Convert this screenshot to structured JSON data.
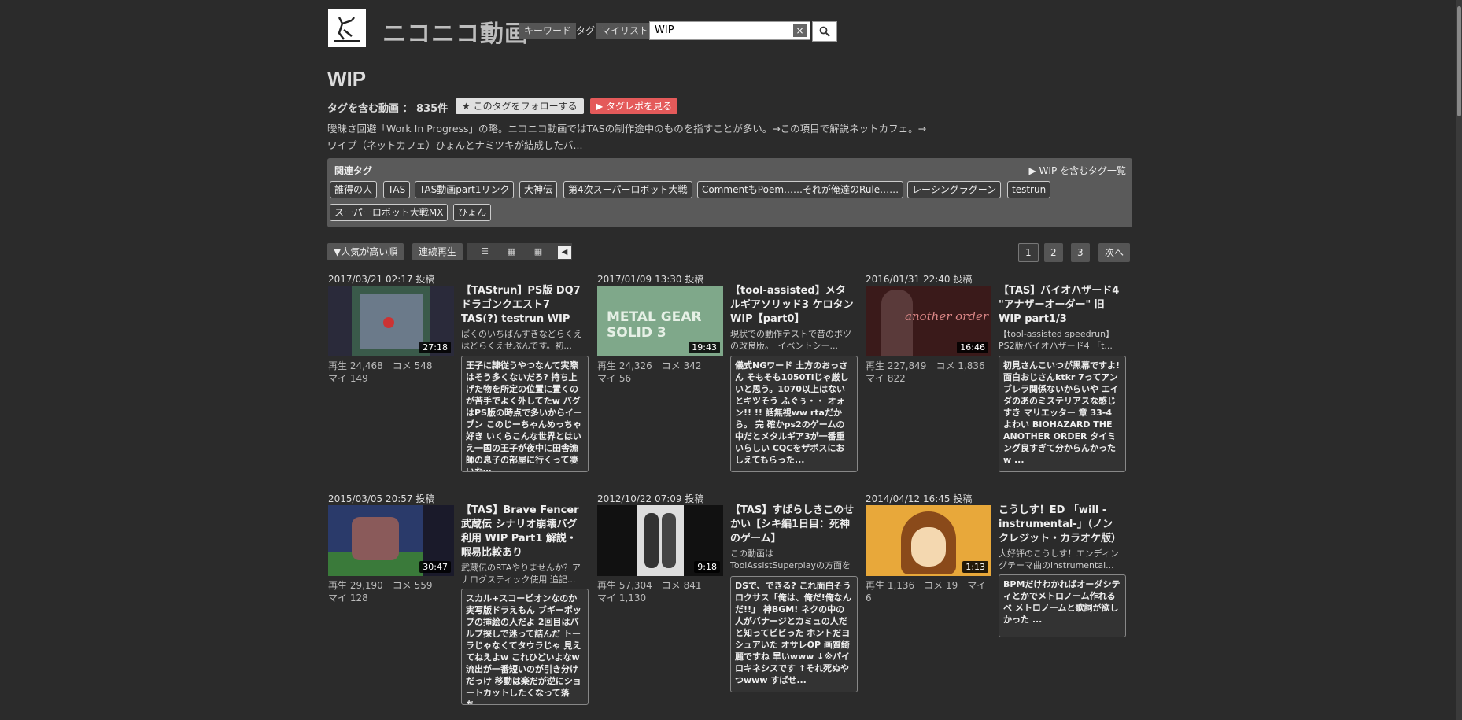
{
  "header": {
    "logo_text": "ニコニコ動画",
    "search_tabs": [
      "キーワード",
      "タグ",
      "マイリスト"
    ],
    "search_value": "WIP",
    "clear_symbol": "×",
    "search_icon": "magnifier-icon"
  },
  "tag_page": {
    "title": "WIP",
    "count_label": "タグを含む動画 ： 835件",
    "follow_label": "★ このタグをフォローする",
    "repo_label": "▶ タグレポを見る",
    "description": "曖昧さ回避「Work In Progress」の略。ニコニコ動画ではTASの制作途中のものを指すことが多い。→この項目で解説ネットカフェ。→ワイプ（ネットカフェ）ひょんとナミツキが結成したバ..."
  },
  "related": {
    "title": "関連タグ",
    "all_link": "▶ WIP を含むタグ一覧",
    "tags": [
      "誰得の人",
      "TAS",
      "TAS動画part1リンク",
      "大神伝",
      "第4次スーパーロボット大戦",
      "CommentもPoem……それが俺達のRule……",
      "レーシングラグーン",
      "testrun",
      "スーパーロボット大戦MX",
      "ひょん"
    ]
  },
  "controls": {
    "sort_label": "▼人気が高い順",
    "continuous_label": "連続再生",
    "view_icons": [
      "list-view-icon",
      "grid-small-icon",
      "grid-large-icon"
    ],
    "collapse_symbol": "◀",
    "pages": [
      "1",
      "2",
      "3"
    ],
    "next_label": "次へ"
  },
  "videos": [
    {
      "date": "2017/03/21 02:17 投稿",
      "duration": "27:18",
      "title": "【TAStrun】PS版 DQ7 ドラゴンクエスト7 TAS(?) testrun WIP",
      "stats": "再生 24,468　コメ 548\nマイ 149",
      "desc": "ぱくのいちばんすきなどらくえはどらくえせぶんです。初...",
      "comments": "王子に隷従うやつなんて実際はそう多くないだろ? 持ち上げた物を所定の位置に置くのが苦手でよく外してたw バグはPS版の時点で多いからイーブン このじーちゃんめっちゃ好き いくらこんな世界とはいえ一国の王子が夜中に田舎漁師の息子の部屋に行くって凄いなw...",
      "thumb_color": "#2a2a3a"
    },
    {
      "date": "2017/01/09 13:30 投稿",
      "duration": "19:43",
      "title": "【tool-assisted】メタルギアソリッド3 ケロタン WIP【part0】",
      "stats": "再生 24,326　コメ 342\nマイ 56",
      "desc": "現状での動作テストで昔のボツの改良版。　イベントシー...",
      "comments": "儀式NGワード 土方のおっさん そもそも1050Tiじゃ厳しいと思う。1070以上はないとキツそう ふぐぅ・・ オォン!! !! 話無視ww rtaだから。 完 確かps2のゲームの中だとメタルギア3が一番重いらしい CQCをザボスにおしえてもらった...",
      "thumb_color": "#7fa88a",
      "thumb_text": "METAL GEAR SOLID 3"
    },
    {
      "date": "2016/01/31 22:40 投稿",
      "duration": "16:46",
      "title": "【TAS】バイオハザード4 \"アナザーオーダー\" 旧 WIP part1/3",
      "stats": "再生 227,849　コメ 1,836\nマイ 822",
      "desc": "【tool-assisted speedrun】PS2版バイオハザード4 「t...",
      "comments": "初見さんこいつが黒幕ですよ! 面白おじさんktkr 7ってアンブレラ関係ないからいや エイダのあのミステリアスな感じすき マリエッター 章 33-4 よわい BIOHAZARD THE ANOTHER ORDER タイミング良すぎて分からんかったw ...",
      "thumb_color": "#5a2a2a",
      "thumb_text": "another order"
    },
    {
      "date": "2015/03/05 20:57 投稿",
      "duration": "30:47",
      "title": "【TAS】Brave Fencer 武蔵伝 シナリオ崩壊バグ利用 WIP Part1 解説・暇易比較あり",
      "stats": "再生 29,190　コメ 559\nマイ 128",
      "desc": "武蔵伝のRTAやりませんか？アナログスティック使用 追記...",
      "comments": "スカル+スコーピオンなのか 実写版ドラえもん ブギーポップの挿絵の人だよ 2回目はバルブ探しで迷って詰んだ トーラじゃなくてタウラじゃ 見えてねえよw これひどいよなw 流出が一番短いのが引き分けだっけ 移動は楽だが逆にショートカットしたくなって落ち...",
      "thumb_color": "#3a4a7a"
    },
    {
      "date": "2012/10/22 07:09 投稿",
      "duration": "9:18",
      "title": "【TAS】すばらしきこのせかい【シキ編1日目：死神のゲーム】",
      "stats": "再生 57,304　コメ 841\nマイ 1,130",
      "desc": "この動画はToolAssistSuperplayの方面を目指していきます...",
      "comments": "DSで、できる? これ面白そう ロクサス「俺は、俺だ!俺なんだ!!」 神BGM! ネクの中の人がバナージとカミュの人だと知ってビビった ホントだヨシュアいた オサレOP 画質綺麗ですね 早いwww ↓※パイロキネシスです ↑それ死ぬやつwww すばせ...",
      "thumb_color": "#1a1a1a"
    },
    {
      "date": "2014/04/12 16:45 投稿",
      "duration": "1:13",
      "title": "こうしす！ED 「will -instrumental-」（ノンクレジット・カラオケ版）",
      "stats": "再生 1,136　コメ 19　マイ 6",
      "desc": "大好評のこうしす！エンディングテーマ曲のinstrumental...",
      "comments": "BPMだけわかればオーダシティとかでメトロノーム作れるべ メトロノームと歌詞が欲しかった ...",
      "thumb_color": "#e8a83a"
    }
  ]
}
